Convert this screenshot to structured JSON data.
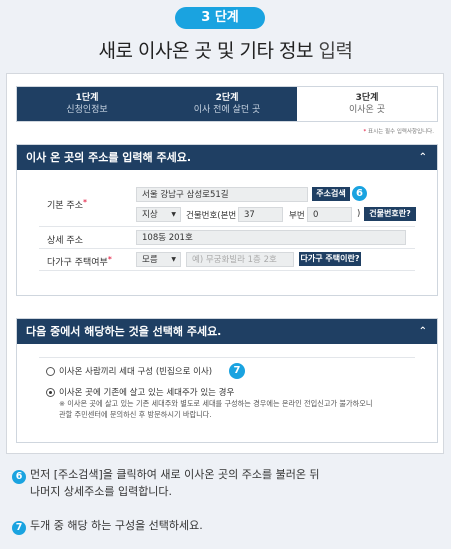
{
  "header": {
    "step_badge": "3 단계",
    "title_main": "새로 이사온 곳 및 기타 정보 ",
    "title_light": "입력"
  },
  "tabs": [
    {
      "label": "1단계",
      "sub": "신청인정보"
    },
    {
      "label": "2단계",
      "sub": "이사 전에 살던 곳"
    },
    {
      "label": "3단계",
      "sub": "이사온 곳"
    }
  ],
  "required_note": {
    "star": "*",
    "text": " 표시는 필수 입력사항입니다."
  },
  "address_panel": {
    "title": "이사 온 곳의 주소를 입력해 주세요.",
    "basic_address_label": "기본 주소",
    "basic_address_value": "서울 강남구 삼성로51길",
    "search_button": "주소검색",
    "land_type": "지상",
    "building_no_label": "건물번호(본번",
    "building_no_value": "37",
    "sub_no_label": "부번",
    "sub_no_value": "0",
    "paren_close": ")",
    "building_no_help_button": "건물번호란?",
    "detail_address_label": "상세 주소",
    "detail_address_value": "108동 201호",
    "multi_label": "다가구 주택여부",
    "multi_select": "모름",
    "multi_placeholder": "예) 무궁화빌라 1층 2호",
    "multi_help_button": "다가구 주택이란?"
  },
  "choice_panel": {
    "title": "다음 중에서 해당하는 것을 선택해 주세요.",
    "option1": "이사온 사람끼리 세대 구성 (빈집으로 이사)",
    "option2": "이사온 곳에 기존에 살고 있는 세대주가 있는 경우",
    "note_line1": "※ 이사온 곳에 살고 있는 기존 세대주와 별도로 세대를 구성하는 경우에는 온라인 전입신고가 불가하오니",
    "note_line2": "관할 주민센터에 문의하신 후 방문하시기 바랍니다."
  },
  "markers": {
    "m6": "6",
    "m7": "7"
  },
  "guide": {
    "line6a": "먼저 [주소검색]을 클릭하여 새로 이사온 곳의 주소를 불러온 뒤",
    "line6b": "나머지 상세주소를 입력합니다.",
    "line7": "두개 중 해당 하는 구성을 선택하세요."
  },
  "colors": {
    "accent": "#1aa3e0",
    "navy": "#1f3f63",
    "required": "#e0002a"
  }
}
